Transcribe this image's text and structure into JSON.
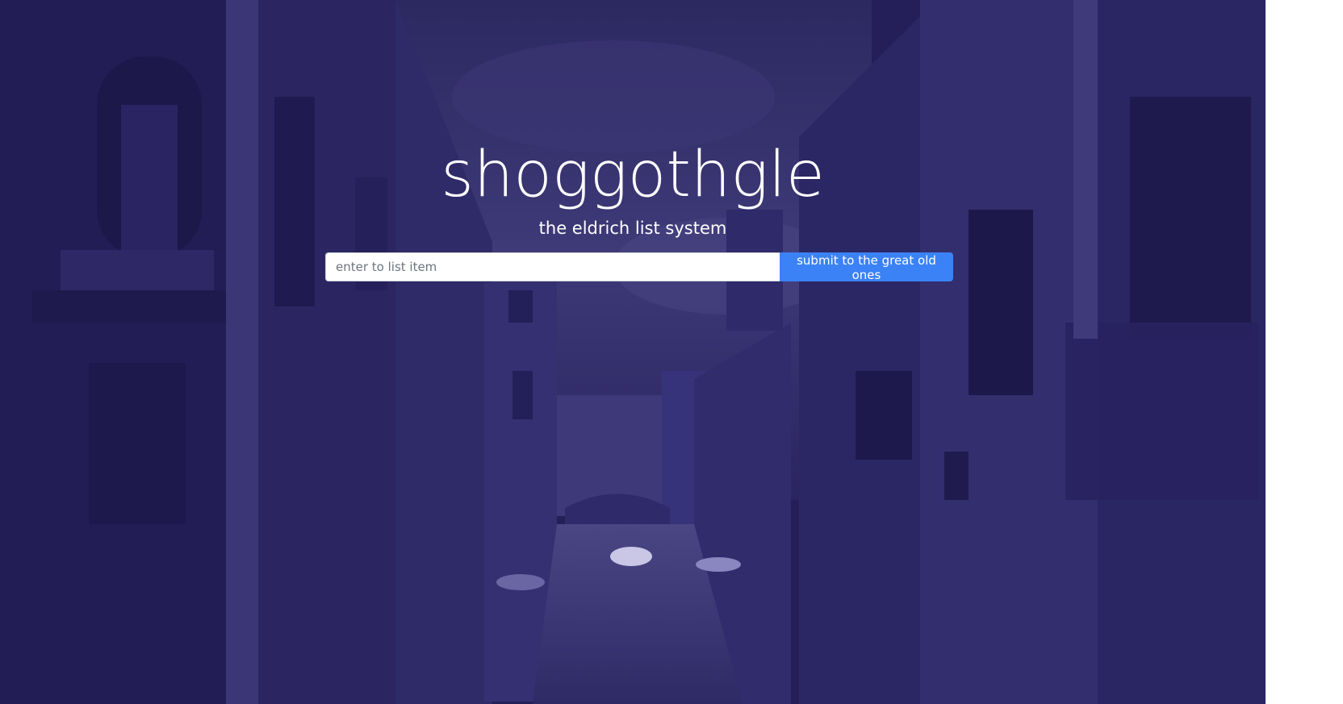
{
  "app": {
    "title": "shoggothgle",
    "subtitle": "the eldrich list system"
  },
  "form": {
    "input_placeholder": "enter to list item",
    "input_value": "",
    "submit_label": "submit to the great old ones"
  },
  "colors": {
    "overlay": "#241f58",
    "button": "#3b82f6",
    "text": "#ffffff"
  }
}
